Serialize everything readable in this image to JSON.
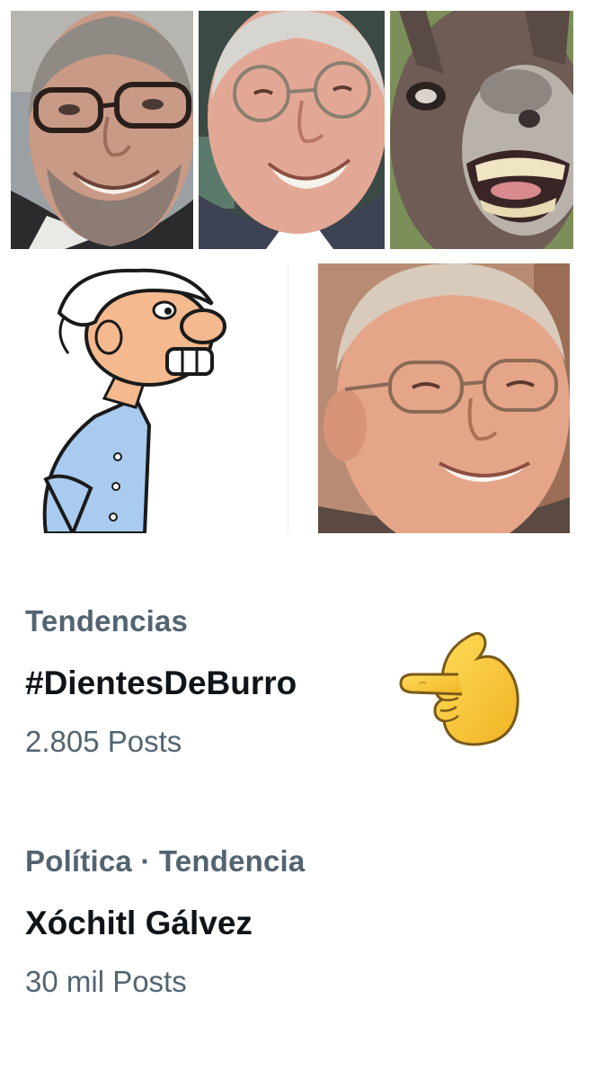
{
  "collage": {
    "images": [
      {
        "name": "man-with-glasses-grinning"
      },
      {
        "name": "smiling-man-with-round-glasses"
      },
      {
        "name": "donkey-showing-teeth"
      },
      {
        "name": "cartoon-old-man-with-buck-teeth"
      },
      {
        "name": "smiling-man-closeup"
      }
    ]
  },
  "trends": [
    {
      "meta": "Tendencias",
      "name": "#DientesDeBurro",
      "count": "2.805 Posts"
    },
    {
      "meta": "Política · Tendencia",
      "name": "Xóchitl Gálvez",
      "count": "30 mil Posts"
    }
  ],
  "pointer_emoji": {
    "icon": "backhand-index-pointing-left-icon",
    "color": "#F5C534"
  }
}
